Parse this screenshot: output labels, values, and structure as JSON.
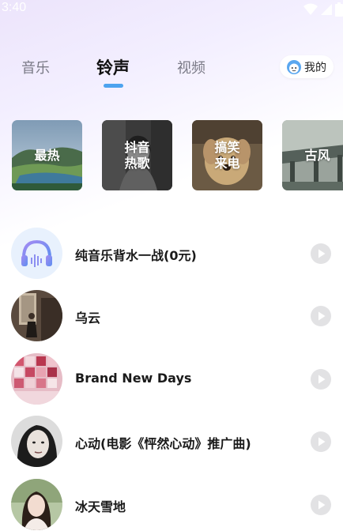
{
  "status_bar": {
    "time": "3:40"
  },
  "tabs": [
    {
      "label": "音乐",
      "active": false
    },
    {
      "label": "铃声",
      "active": true
    },
    {
      "label": "视频",
      "active": false
    }
  ],
  "mine_button": {
    "label": "我的",
    "icon": "face-avatar-icon"
  },
  "categories": [
    {
      "label": "最热",
      "icon": "landscape-thumbnail"
    },
    {
      "label": "抖音\n热歌",
      "icon": "portrait-thumbnail"
    },
    {
      "label": "搞笑\n来电",
      "icon": "puppy-thumbnail"
    },
    {
      "label": "古风",
      "icon": "architecture-thumbnail"
    }
  ],
  "songs": [
    {
      "title": "纯音乐背水一战(0元)",
      "avatar": "headphones-icon"
    },
    {
      "title": "乌云",
      "avatar": "photo-avatar"
    },
    {
      "title": "Brand New Days",
      "avatar": "album-collage-avatar"
    },
    {
      "title": "心动(电影《怦然心动》推广曲)",
      "avatar": "photo-avatar"
    },
    {
      "title": "冰天雪地",
      "avatar": "photo-avatar"
    }
  ],
  "colors": {
    "accent": "#4da3ef",
    "play_button": "#e2e2e4"
  }
}
